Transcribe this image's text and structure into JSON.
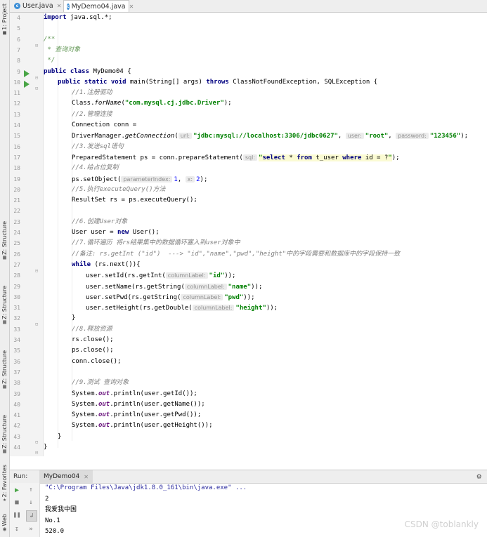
{
  "side_tabs": [
    {
      "label": "1: Project",
      "icon": "folder-icon"
    },
    {
      "label": "Z: Structure",
      "icon": "structure-icon"
    },
    {
      "label": "Z: Structure",
      "icon": "structure-icon"
    },
    {
      "label": "Z: Structure",
      "icon": "structure-icon"
    },
    {
      "label": "Z: Structure",
      "icon": "structure-icon"
    },
    {
      "label": "2: Favorites",
      "icon": "star-icon"
    },
    {
      "label": "Web",
      "icon": "web-icon"
    }
  ],
  "tabs": [
    {
      "label": "User.java",
      "icon": "java-class-icon"
    },
    {
      "label": "MyDemo04.java",
      "icon": "java-class-icon"
    }
  ],
  "editor": {
    "line_numbers": [
      "4",
      "5",
      "6",
      "7",
      "8",
      "9",
      "10",
      "11",
      "12",
      "13",
      "14",
      "15",
      "16",
      "17",
      "18",
      "19",
      "20",
      "21",
      "22",
      "23",
      "24",
      "25",
      "26",
      "27",
      "28",
      "29",
      "30",
      "31",
      "32",
      "33",
      "34",
      "35",
      "36",
      "37",
      "38",
      "39",
      "40",
      "41",
      "42",
      "43",
      "44"
    ],
    "lines": {
      "l4": {
        "kw": "import",
        "t": " java.sql.*;"
      },
      "l6": "/**",
      "l7": " * 查询对象",
      "l8": " */",
      "l9": {
        "kw1": "public class",
        "t": " MyDemo04 {"
      },
      "l10": {
        "kw1": "public static void",
        "t1": " main(String[] args) ",
        "kw2": "throws",
        "t2": " ClassNotFoundException, SQLException {"
      },
      "l11": "//1.注册驱动",
      "l12": {
        "t1": "Class.",
        "m": "forName",
        "t2": "(",
        "s": "\"com.mysql.cj.jdbc.Driver\"",
        "t3": ");"
      },
      "l13": "//2.管理连接",
      "l14": "Connection conn =",
      "l15": {
        "t1": "DriverManager.",
        "m": "getConnection",
        "t2": "(",
        "h1": "url:",
        "s1": "\"jdbc:mysql://localhost:3306/jdbc0627\"",
        "t3": ", ",
        "h2": "user:",
        "s2": "\"root\"",
        "t4": ", ",
        "h3": "password:",
        "s3": "\"123456\"",
        "t5": ");"
      },
      "l16": "//3.发送sql语句",
      "l17": {
        "t1": "PreparedStatement ps = conn.prepareStatement(",
        "h": "sql:",
        "q": "\"",
        "k1": "select",
        "t2": " * ",
        "k2": "from",
        "t3": " t_user ",
        "k3": "where",
        "t4": " id = ?",
        "q2": "\"",
        "t5": ");"
      },
      "l18": "//4.给占位复制",
      "l19": {
        "t1": "ps.setObject(",
        "h1": "parameterIndex:",
        "n1": "1",
        "t2": ", ",
        "h2": "x:",
        "n2": "2",
        "t3": ");"
      },
      "l20": "//5.执行executeQuery()方法",
      "l21": "ResultSet rs = ps.executeQuery();",
      "l23": "//6.创建User对象",
      "l24": {
        "t1": "User user = ",
        "kw": "new",
        "t2": " User();"
      },
      "l25": "//7.循环遍历 将rs结果集中的数据循环塞入到user对象中",
      "l26": "//备注: rs.getInt (\"id\")  ---> \"id\",\"name\",\"pwd\",\"height\"中的字段需要和数据库中的字段保持一致",
      "l27": {
        "kw": "while",
        "t": " (rs.next()){"
      },
      "l28": {
        "t1": "user.setId(rs.getInt(",
        "h": "columnLabel:",
        "s": "\"id\"",
        "t2": "));"
      },
      "l29": {
        "t1": "user.setName(rs.getString(",
        "h": "columnLabel:",
        "s": "\"name\"",
        "t2": "));"
      },
      "l30": {
        "t1": "user.setPwd(rs.getString(",
        "h": "columnLabel:",
        "s": "\"pwd\"",
        "t2": "));"
      },
      "l31": {
        "t1": "user.setHeight(rs.getDouble(",
        "h": "columnLabel:",
        "s": "\"height\"",
        "t2": "));"
      },
      "l32": "}",
      "l33": "//8.释放资源",
      "l34": "rs.close();",
      "l35": "ps.close();",
      "l36": "conn.close();",
      "l38": "//9.测试 查询对象",
      "l39": {
        "t1": "System.",
        "f": "out",
        "t2": ".println(user.getId());"
      },
      "l40": {
        "t1": "System.",
        "f": "out",
        "t2": ".println(user.getName());"
      },
      "l41": {
        "t1": "System.",
        "f": "out",
        "t2": ".println(user.getPwd());"
      },
      "l42": {
        "t1": "System.",
        "f": "out",
        "t2": ".println(user.getHeight());"
      },
      "l43": "}",
      "l44": "}"
    }
  },
  "run": {
    "label": "Run:",
    "tab": "MyDemo04",
    "output": [
      "\"C:\\Program Files\\Java\\jdk1.8.0_161\\bin\\java.exe\" ...",
      "2",
      "我爱我中国",
      "No.1",
      "520.0"
    ]
  },
  "watermark": "CSDN @toblankly"
}
